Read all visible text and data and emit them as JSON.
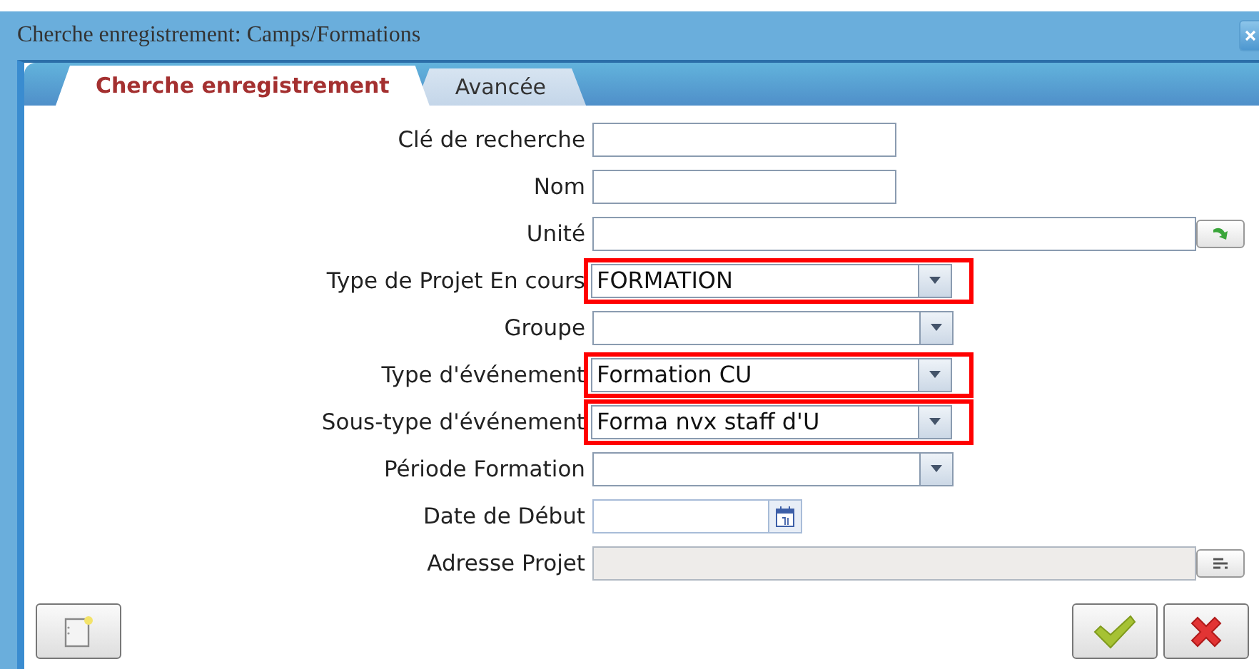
{
  "window": {
    "title": "Cherche enregistrement: Camps/Formations"
  },
  "tabs": [
    {
      "label": "Cherche enregistrement",
      "selected": true
    },
    {
      "label": "Avancée",
      "selected": false
    }
  ],
  "fields": [
    {
      "kind": "text",
      "label": "Clé de recherche",
      "highlighted": false
    },
    {
      "kind": "text",
      "label": "Nom",
      "highlighted": false
    },
    {
      "kind": "lookup",
      "label": "Unité",
      "highlighted": false
    },
    {
      "kind": "select",
      "label": "Type de Projet En cours",
      "value": "FORMATION",
      "highlighted": true
    },
    {
      "kind": "select",
      "label": "Groupe",
      "highlighted": false
    },
    {
      "kind": "select",
      "label": "Type d'événement",
      "value": "Formation CU",
      "highlighted": true
    },
    {
      "kind": "select",
      "label": "Sous-type d'événement",
      "value": "Forma nvx staff d'U",
      "highlighted": true
    },
    {
      "kind": "select",
      "label": "Période Formation",
      "highlighted": false
    },
    {
      "kind": "date",
      "label": "Date de Début",
      "highlighted": false
    },
    {
      "kind": "address",
      "label": "Adresse Projet",
      "highlighted": false,
      "disabled": true
    }
  ]
}
